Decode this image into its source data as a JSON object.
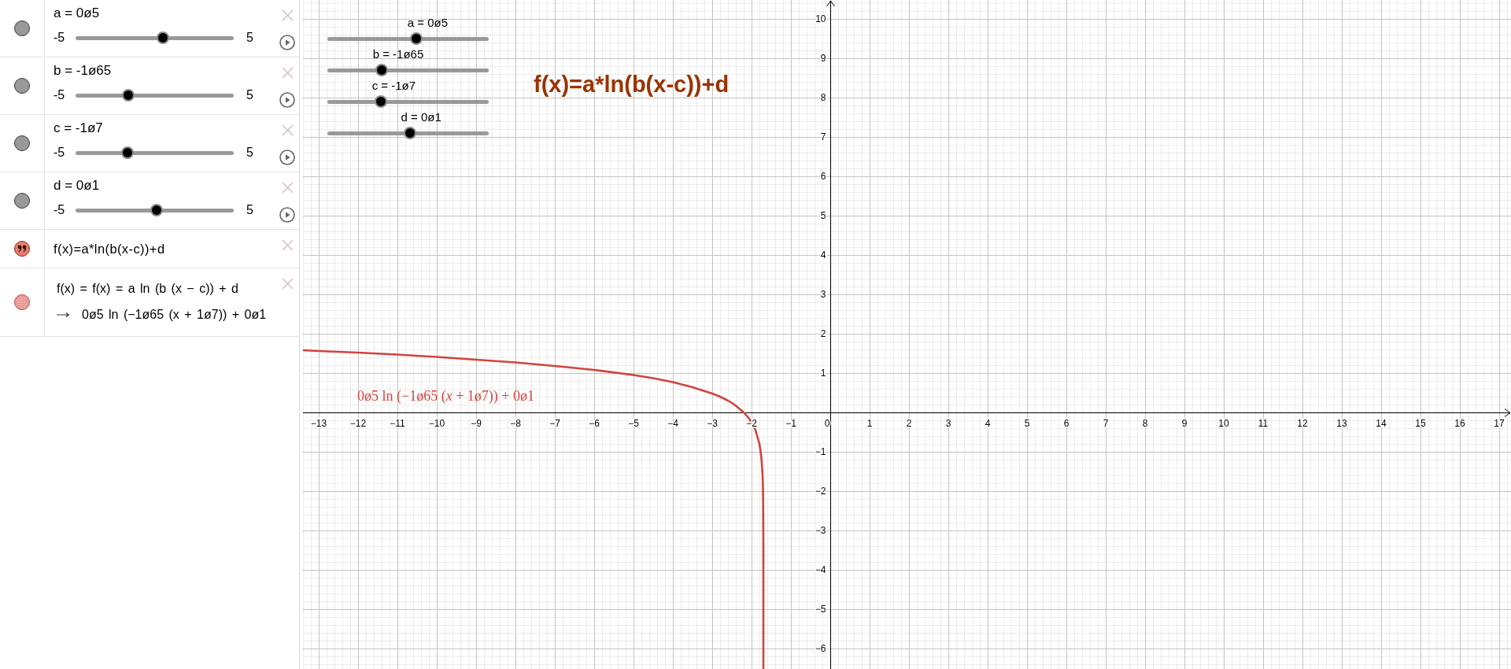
{
  "algebra_view": {
    "items": [
      {
        "kind": "slider",
        "color": "#999999",
        "label": "a = 0ø5",
        "min": "-5",
        "max": "5",
        "level": 0.55
      },
      {
        "kind": "slider",
        "color": "#999999",
        "label": "b = -1ø65",
        "min": "-5",
        "max": "5",
        "level": 0.335
      },
      {
        "kind": "slider",
        "color": "#999999",
        "label": "c = -1ø7",
        "min": "-5",
        "max": "5",
        "level": 0.33
      },
      {
        "kind": "slider",
        "color": "#999999",
        "label": "d = 0ø1",
        "min": "-5",
        "max": "5",
        "level": 0.51
      },
      {
        "kind": "text",
        "color": "#e5806d",
        "text": "f(x)=a*ln(b(x-c))+d"
      },
      {
        "kind": "function",
        "color": "#eda6a3",
        "definition": "f(x) = f(x) = a ln (b (x − c)) + d",
        "value": "0ø5 ln (−1ø65 (x + 1ø7)) + 0ø1"
      }
    ]
  },
  "graphics_view": {
    "sliders": [
      {
        "label": "a = 0ø5",
        "level": 0.55
      },
      {
        "label": "b = -1ø65",
        "level": 0.335
      },
      {
        "label": "c = -1ø7",
        "level": 0.33
      },
      {
        "label": "d = 0ø1",
        "level": 0.51
      }
    ],
    "text": "f(x)=a*ln(b(x-c))+d",
    "chart_data": {
      "type": "line",
      "x": [
        -13.4,
        -13,
        -12,
        -11,
        -10,
        -9,
        -8,
        -7,
        -6,
        -5,
        -4.5,
        -4,
        -3.5,
        -3,
        -2.8,
        -2.6,
        -2.5,
        -2.4,
        -2.2,
        -2.1,
        -2,
        -1.9,
        -1.8,
        -1.75,
        -1.72,
        -1.71,
        -1.705,
        -1.701,
        -1.7001,
        -1.70001,
        -1.7000011
      ],
      "series": [
        {
          "name": "0ø5 ln (−1ø65 (*x* + 1ø7)) + 0ø1",
          "color": "#d2433d",
          "values": [
            1.58,
            1.56,
            1.52,
            1.47,
            1.41,
            1.34,
            1.27,
            1.18,
            1.08,
            0.95,
            0.87,
            0.77,
            0.64,
            0.48,
            0.4,
            0.3,
            0.24,
            0.17,
            0,
            -0.11,
            -0.25,
            -0.45,
            -0.8,
            -1.15,
            -1.61,
            -1.95,
            -2.3,
            -3.1,
            -4.25,
            -5.41,
            -6.51
          ]
        }
      ],
      "xlim": [
        -13.4,
        17.3
      ],
      "ylim": [
        -6.52,
        10.48
      ],
      "xticks": [
        {
          "value": -13,
          "label": "−13"
        },
        {
          "value": -12,
          "label": "−12"
        },
        {
          "value": -11,
          "label": "−11"
        },
        {
          "value": -10,
          "label": "−10"
        },
        {
          "value": -9,
          "label": "−9"
        },
        {
          "value": -8,
          "label": "−8"
        },
        {
          "value": -7,
          "label": "−7"
        },
        {
          "value": -6,
          "label": "−6"
        },
        {
          "value": -5,
          "label": "−5"
        },
        {
          "value": -4,
          "label": "−4"
        },
        {
          "value": -3,
          "label": "−3"
        },
        {
          "value": -2,
          "label": "−2"
        },
        {
          "value": -1,
          "label": "−1"
        },
        0,
        1,
        2,
        3,
        4,
        5,
        6,
        7,
        8,
        9,
        10,
        11,
        12,
        13,
        14,
        15,
        16,
        17
      ],
      "yticks": [
        {
          "value": -6,
          "label": "−6"
        },
        {
          "value": -5,
          "label": "−5"
        },
        {
          "value": -4,
          "label": "−4"
        },
        {
          "value": -3,
          "label": "−3"
        },
        {
          "value": -2,
          "label": "−2"
        },
        {
          "value": -1,
          "label": "−1"
        },
        1,
        2,
        3,
        4,
        5,
        6,
        7,
        8,
        9,
        10
      ],
      "grid": true
    }
  }
}
